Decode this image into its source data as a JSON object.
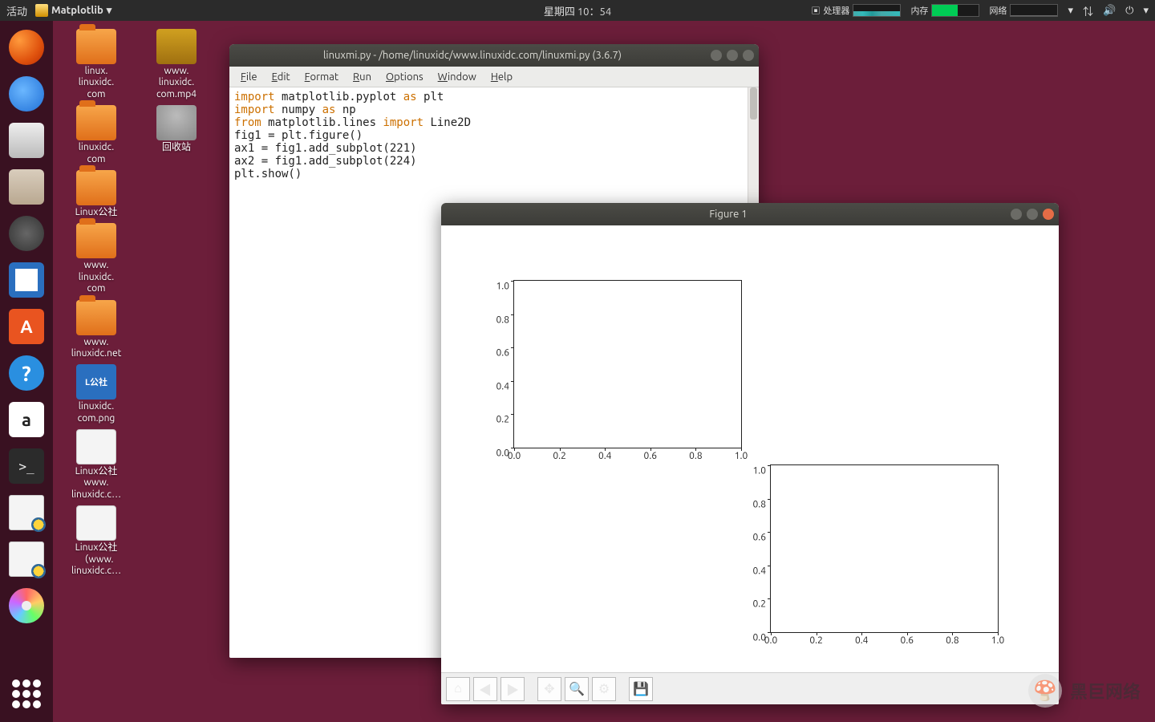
{
  "topbar": {
    "activities": "活动",
    "app_name": "Matplotlib",
    "clock": "星期四 10：54",
    "cpu_label": "处理器",
    "mem_label": "内存",
    "net_label": "网络"
  },
  "dock": [
    {
      "name": "firefox",
      "cls": "di-firefox"
    },
    {
      "name": "thunderbird",
      "cls": "di-thunderbird"
    },
    {
      "name": "camera",
      "cls": "di-camera"
    },
    {
      "name": "files",
      "cls": "di-files"
    },
    {
      "name": "music",
      "cls": "di-music"
    },
    {
      "name": "writer",
      "cls": "di-writer"
    },
    {
      "name": "software",
      "cls": "di-software",
      "text": "A"
    },
    {
      "name": "help",
      "cls": "di-help",
      "text": "?"
    },
    {
      "name": "amazon",
      "cls": "di-amazon",
      "text": "a"
    },
    {
      "name": "terminal",
      "cls": "di-terminal",
      "text": ">_"
    },
    {
      "name": "python-file-1",
      "cls": "di-pyfile"
    },
    {
      "name": "python-file-2",
      "cls": "di-pyfile"
    },
    {
      "name": "cd",
      "cls": "di-cd"
    }
  ],
  "desktop": {
    "col1": [
      {
        "label": "linux.\nlinuxidc.\ncom",
        "kind": "folder"
      },
      {
        "label": "linuxidc.\ncom",
        "kind": "folder"
      },
      {
        "label": "Linux公社",
        "kind": "folder"
      },
      {
        "label": "www.\nlinuxidc.\ncom",
        "kind": "folder"
      },
      {
        "label": "www.\nlinuxidc.net",
        "kind": "folder"
      },
      {
        "label": "linuxidc.\ncom.png",
        "kind": "png",
        "text": "L公社"
      },
      {
        "label": "Linux公社\nwww.\nlinuxidc.c…",
        "kind": "file"
      },
      {
        "label": "Linux公社\n（www.\nlinuxidc.c…",
        "kind": "file"
      }
    ],
    "col2": [
      {
        "label": "www.\nlinuxidc.\ncom.mp4",
        "kind": "video"
      },
      {
        "label": "回收站",
        "kind": "trash"
      }
    ]
  },
  "editor": {
    "title": "linuxmi.py - /home/linuxidc/www.linuxidc.com/linuxmi.py (3.6.7)",
    "menus": [
      "File",
      "Edit",
      "Format",
      "Run",
      "Options",
      "Window",
      "Help"
    ],
    "code": [
      {
        "t": "import",
        "c": "kw"
      },
      {
        "t": " matplotlib.pyplot "
      },
      {
        "t": "as",
        "c": "kw"
      },
      {
        "t": " plt\n"
      },
      {
        "t": "import",
        "c": "kw"
      },
      {
        "t": " numpy "
      },
      {
        "t": "as",
        "c": "kw"
      },
      {
        "t": " np\n"
      },
      {
        "t": "from",
        "c": "kw"
      },
      {
        "t": " matplotlib.lines "
      },
      {
        "t": "import",
        "c": "kw"
      },
      {
        "t": " Line2D\n"
      },
      {
        "t": "\n"
      },
      {
        "t": "fig1 = plt.figure()\n"
      },
      {
        "t": "\n"
      },
      {
        "t": "ax1 = fig1.add_subplot(221)\n"
      },
      {
        "t": "ax2 = fig1.add_subplot(224)\n"
      },
      {
        "t": "\n"
      },
      {
        "t": "plt.show()\n"
      }
    ]
  },
  "figure": {
    "title": "Figure 1",
    "toolbar": [
      "home",
      "back",
      "forward",
      "|",
      "pan",
      "zoom",
      "subplots",
      "|",
      "save"
    ],
    "icons": {
      "home": "⌂",
      "back": "◀",
      "forward": "▶",
      "pan": "✥",
      "zoom": "🔍",
      "subplots": "⚙",
      "save": "💾"
    }
  },
  "chart_data": [
    {
      "type": "line",
      "subplot": 221,
      "x": [],
      "y": [],
      "xlim": [
        0.0,
        1.0
      ],
      "ylim": [
        0.0,
        1.0
      ],
      "xticks": [
        0.0,
        0.2,
        0.4,
        0.6,
        0.8,
        1.0
      ],
      "yticks": [
        0.0,
        0.2,
        0.4,
        0.6,
        0.8,
        1.0
      ],
      "title": "",
      "xlabel": "",
      "ylabel": ""
    },
    {
      "type": "line",
      "subplot": 224,
      "x": [],
      "y": [],
      "xlim": [
        0.0,
        1.0
      ],
      "ylim": [
        0.0,
        1.0
      ],
      "xticks": [
        0.0,
        0.2,
        0.4,
        0.6,
        0.8,
        1.0
      ],
      "yticks": [
        0.0,
        0.2,
        0.4,
        0.6,
        0.8,
        1.0
      ],
      "title": "",
      "xlabel": "",
      "ylabel": ""
    }
  ],
  "watermark": {
    "text": "黑巨网络"
  }
}
